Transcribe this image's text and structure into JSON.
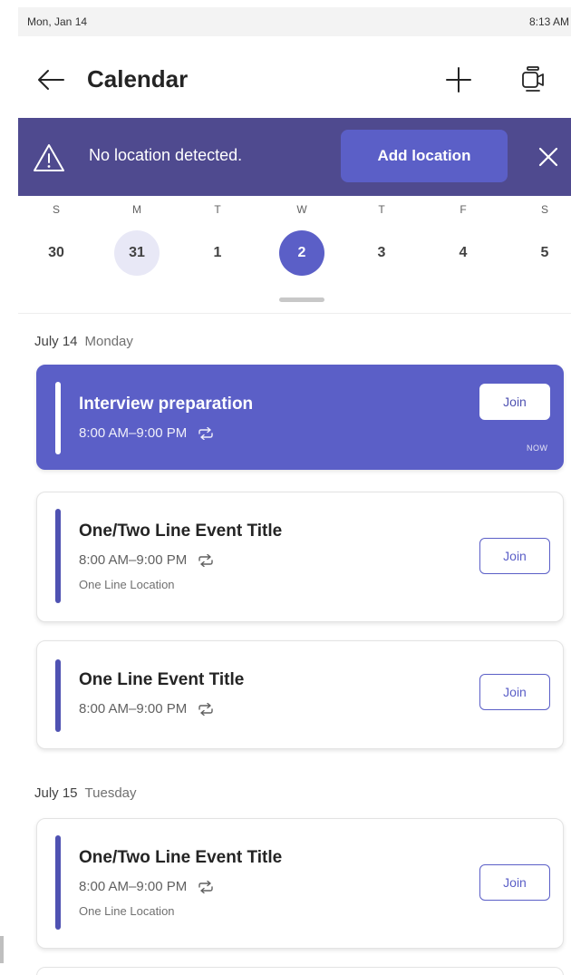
{
  "status_bar": {
    "date": "Mon, Jan 14",
    "time": "8:13 AM"
  },
  "header": {
    "title": "Calendar"
  },
  "banner": {
    "message": "No location detected.",
    "button_label": "Add location"
  },
  "week": {
    "days": [
      {
        "letter": "S",
        "number": "30",
        "state": "normal"
      },
      {
        "letter": "M",
        "number": "31",
        "state": "today"
      },
      {
        "letter": "T",
        "number": "1",
        "state": "normal"
      },
      {
        "letter": "W",
        "number": "2",
        "state": "selected"
      },
      {
        "letter": "T",
        "number": "3",
        "state": "normal"
      },
      {
        "letter": "F",
        "number": "4",
        "state": "normal"
      },
      {
        "letter": "S",
        "number": "5",
        "state": "normal"
      }
    ]
  },
  "sections": [
    {
      "date": "July 14",
      "weekday": "Monday",
      "events": [
        {
          "title": "Interview preparation",
          "time": "8:00 AM–9:00 PM",
          "location": "",
          "join_label": "Join",
          "badge": "NOW",
          "active": true
        },
        {
          "title": "One/Two Line Event Title",
          "time": "8:00 AM–9:00 PM",
          "location": "One Line Location",
          "join_label": "Join",
          "badge": "",
          "active": false
        },
        {
          "title": "One Line Event Title",
          "time": "8:00 AM–9:00 PM",
          "location": "",
          "join_label": "Join",
          "badge": "",
          "active": false
        }
      ]
    },
    {
      "date": "July 15",
      "weekday": "Tuesday",
      "events": [
        {
          "title": "One/Two Line Event Title",
          "time": "8:00 AM–9:00 PM",
          "location": "One Line Location",
          "join_label": "Join",
          "badge": "",
          "active": false
        }
      ]
    }
  ],
  "icons": {
    "back": "arrow-left-icon",
    "add": "plus-icon",
    "meet": "video-meet-icon",
    "warning": "warning-icon",
    "close": "close-icon",
    "recurring": "repeat-icon"
  },
  "colors": {
    "brand": "#5b5fc7",
    "banner_bg": "#4f4a8f",
    "event_bar": "#4f52b2"
  }
}
